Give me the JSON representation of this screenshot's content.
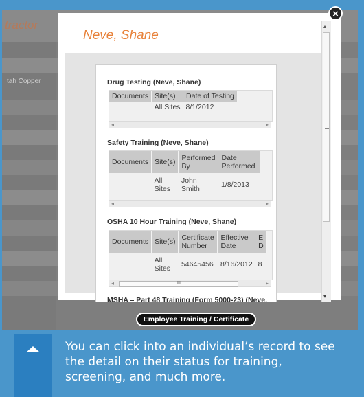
{
  "background": {
    "title_fragment": "tractor",
    "side_text": "tah Copper"
  },
  "modal": {
    "person_name": "Neve, Shane",
    "close_glyph": "×",
    "sections": [
      {
        "heading": "Drug Testing (Neve, Shane)",
        "columns": [
          "Documents",
          "Site(s)",
          "Date of Testing"
        ],
        "rows": [
          [
            "",
            "All Sites",
            "8/1/2012"
          ]
        ]
      },
      {
        "heading": "Safety Training (Neve, Shane)",
        "columns": [
          "Documents",
          "Site(s)",
          "Performed By",
          "Date Performed"
        ],
        "rows": [
          [
            "",
            "All Sites",
            "John Smith",
            "1/8/2013"
          ]
        ]
      },
      {
        "heading": "OSHA 10 Hour Training (Neve, Shane)",
        "columns": [
          "Documents",
          "Site(s)",
          "Certificate Number",
          "Effective Date",
          "E D"
        ],
        "rows": [
          [
            "",
            "All Sites",
            "54645456",
            "8/16/2012",
            "8"
          ]
        ]
      },
      {
        "heading": "MSHA – Part 48 Training (Form 5000-23) (Neve,"
      }
    ],
    "scroll_grip": "III"
  },
  "button": {
    "label": "Employee Training / Certificate"
  },
  "tip": {
    "text": "You can click into an individual’s record to see the detail on their status for training, screening, and much more."
  }
}
